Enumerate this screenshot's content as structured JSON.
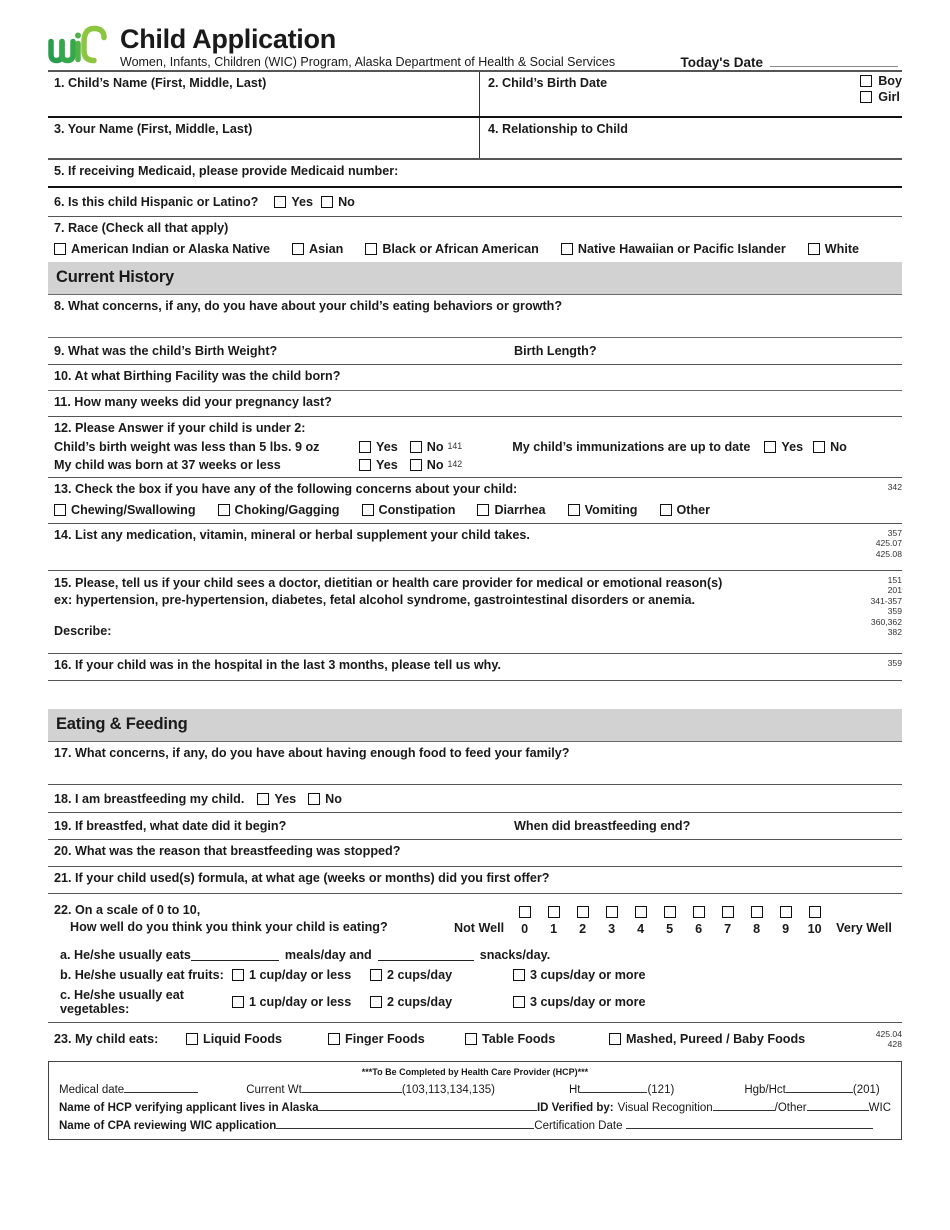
{
  "header": {
    "logo_alt": "wic-logo",
    "title": "Child Application",
    "subtitle": "Women, Infants, Children (WIC) Program, Alaska Department of Health & Social Services",
    "todays_date_label": "Today's Date"
  },
  "identity": {
    "q1_label": "1. Child’s Name (First, Middle, Last)",
    "q2_label": "2. Child’s Birth Date",
    "sex_boy": "Boy",
    "sex_girl": "Girl",
    "q3_label": "3. Your Name (First, Middle, Last)",
    "q4_label": "4. Relationship to Child",
    "q5_label": "5. If receiving Medicaid, please provide Medicaid number:",
    "q6_label": "6. Is this child Hispanic or Latino?",
    "q6_yes": "Yes",
    "q6_no": "No",
    "q7_label": "7. Race (Check all that apply)",
    "q7_options": [
      "American Indian or Alaska Native",
      "Asian",
      "Black or African American",
      "Native Hawaiian or Pacific Islander",
      "White"
    ]
  },
  "current_history": {
    "banner": "Current History",
    "q8": "8. What concerns, if any, do you have about your child’s eating behaviors or growth?",
    "q9": "9. What was the child’s Birth Weight?",
    "q9b": "Birth Length?",
    "q10": "10. At what Birthing Facility was the child born?",
    "q11": "11. How many weeks did your pregnancy last?",
    "q12_title": "12. Please Answer if your child is under 2:",
    "q12_a_text": "Child’s birth weight was less than 5 lbs. 9 oz",
    "q12_a_yes": "Yes",
    "q12_a_no": "No",
    "q12_a_code": "141",
    "q12_b_text": "My child was born at 37 weeks or less",
    "q12_b_yes": "Yes",
    "q12_b_no": "No",
    "q12_b_code": "142",
    "q12_imm_text": "My child’s immunizations are up to date",
    "q12_imm_yes": "Yes",
    "q12_imm_no": "No",
    "q13_label": "13. Check the box if you have any of the following concerns about your child:",
    "q13_code": "342",
    "q13_options": [
      "Chewing/Swallowing",
      "Choking/Gagging",
      "Constipation",
      "Diarrhea",
      "Vomiting",
      "Other"
    ],
    "q14_label": "14. List any medication, vitamin, mineral or herbal supplement your child takes.",
    "q14_codes": [
      "357",
      "425.07",
      "425.08"
    ],
    "q15_line1": "15. Please, tell us if your child sees a doctor, dietitian or health care provider for medical or emotional reason(s)",
    "q15_line2": "ex: hypertension, pre-hypertension, diabetes, fetal alcohol syndrome, gastrointestinal disorders or anemia.",
    "q15_describe": "Describe:",
    "q15_codes": [
      "151",
      "201",
      "341-357",
      "359",
      "360,362",
      "382"
    ],
    "q16_label": "16. If your child was in the hospital in the last 3 months, please tell us why.",
    "q16_code": "359"
  },
  "eating_feeding": {
    "banner": "Eating & Feeding",
    "q17": "17. What concerns, if any, do you have about having enough food to feed your family?",
    "q18": "18. I am breastfeeding my child.",
    "q18_yes": "Yes",
    "q18_no": "No",
    "q19": "19. If breastfed, what date did it begin?",
    "q19b": "When did breastfeeding end?",
    "q20": "20. What was the reason that breastfeeding was stopped?",
    "q21": "21. If your child used(s) formula, at what age (weeks or months) did you first offer?",
    "q22_line1": "22. On a scale of 0 to 10,",
    "q22_line2": "How well do you think you think your child is eating?",
    "q22_not_well": "Not Well",
    "q22_very_well": "Very Well",
    "q22_scale": [
      "0",
      "1",
      "2",
      "3",
      "4",
      "5",
      "6",
      "7",
      "8",
      "9",
      "10"
    ],
    "q22a_lead": "a. He/she usually eats",
    "q22a_mid": "meals/day and",
    "q22a_end": "snacks/day.",
    "q22b_lead": "b. He/she usually eat fruits:",
    "q22c_lead": "c. He/she usually eat vegetables:",
    "cup_options": [
      "1 cup/day or less",
      "2 cups/day",
      "3 cups/day or more"
    ],
    "q23_label": "23. My child eats:",
    "q23_options": [
      "Liquid Foods",
      "Finger Foods",
      "Table Foods",
      "Mashed, Pureed / Baby Foods"
    ],
    "q23_codes": [
      "425.04",
      "428"
    ]
  },
  "hcp": {
    "title": "***To Be Completed by Health Care Provider (HCP)***",
    "medical_date": "Medical date",
    "current_wt": "Current Wt",
    "current_wt_code": "(103,113,134,135)",
    "ht": "Ht",
    "ht_code": "(121)",
    "hgb": "Hgb/Hct",
    "hgb_code": "(201)",
    "hcp_name": "Name of HCP verifying applicant lives in Alaska",
    "id_verified": "ID Verified by:",
    "visual_recognition": "Visual Recognition",
    "other": "/Other",
    "wic": "WIC",
    "cpa_name": "Name of CPA reviewing WIC application",
    "certification_date": "Certification Date"
  },
  "colors": {
    "logo_dark_green": "#2fa84f",
    "logo_mid_green": "#5cb944",
    "logo_light_green": "#8cc63f",
    "banner_gray": "#d2d2d2"
  }
}
